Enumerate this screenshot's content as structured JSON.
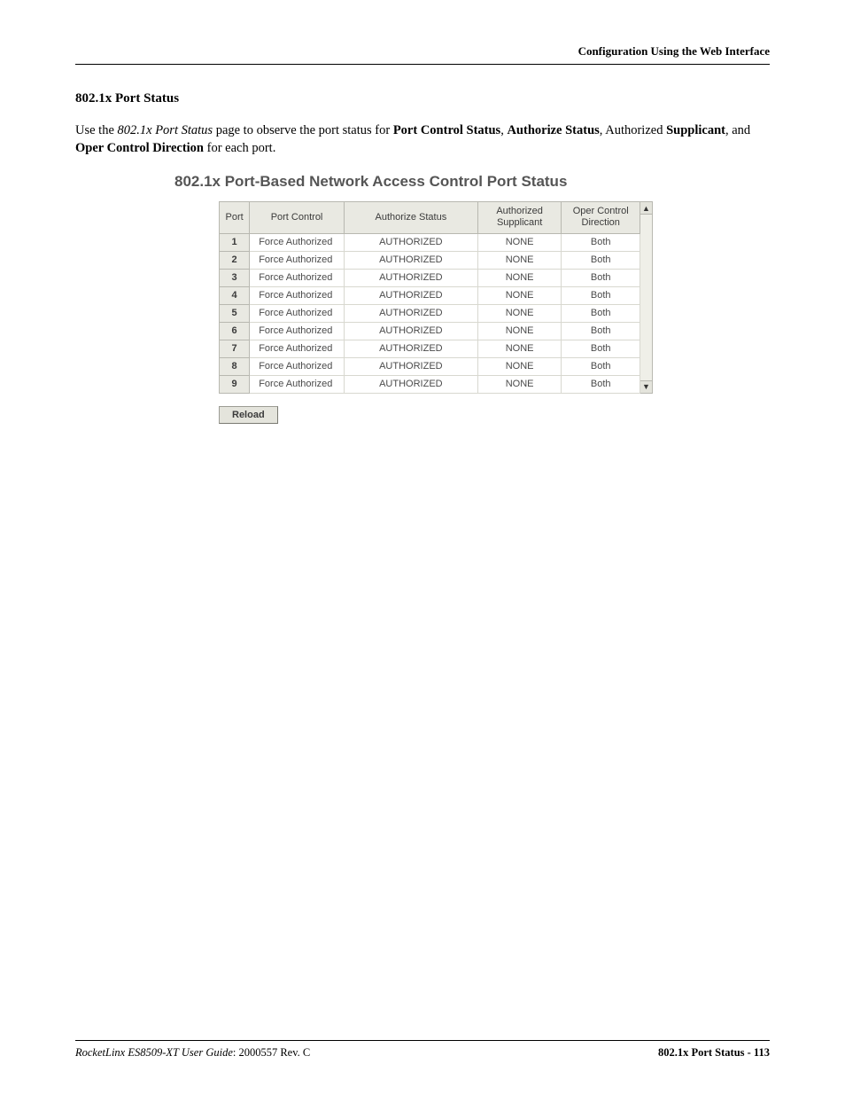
{
  "header": {
    "right": "Configuration Using the Web Interface"
  },
  "section": {
    "title": "802.1x Port Status",
    "intro_prefix": "Use the ",
    "intro_italic": "802.1x Port Status",
    "intro_mid1": " page to observe the port status for ",
    "b1": "Port Control Status",
    "sep1": ", ",
    "b2": "Authorize Status",
    "sep2": ", Authorized ",
    "b3": "Supplicant",
    "sep3": ", and ",
    "b4": "Oper Control Direction",
    "intro_end": " for each port."
  },
  "panel": {
    "title": "802.1x Port-Based Network Access Control Port Status",
    "columns": {
      "port": "Port",
      "port_control": "Port Control",
      "authorize_status": "Authorize Status",
      "authorized_supplicant": "Authorized Supplicant",
      "oper_control_direction": "Oper Control Direction"
    },
    "rows": [
      {
        "port": "1",
        "port_control": "Force Authorized",
        "authorize_status": "AUTHORIZED",
        "authorized_supplicant": "NONE",
        "oper_control_direction": "Both"
      },
      {
        "port": "2",
        "port_control": "Force Authorized",
        "authorize_status": "AUTHORIZED",
        "authorized_supplicant": "NONE",
        "oper_control_direction": "Both"
      },
      {
        "port": "3",
        "port_control": "Force Authorized",
        "authorize_status": "AUTHORIZED",
        "authorized_supplicant": "NONE",
        "oper_control_direction": "Both"
      },
      {
        "port": "4",
        "port_control": "Force Authorized",
        "authorize_status": "AUTHORIZED",
        "authorized_supplicant": "NONE",
        "oper_control_direction": "Both"
      },
      {
        "port": "5",
        "port_control": "Force Authorized",
        "authorize_status": "AUTHORIZED",
        "authorized_supplicant": "NONE",
        "oper_control_direction": "Both"
      },
      {
        "port": "6",
        "port_control": "Force Authorized",
        "authorize_status": "AUTHORIZED",
        "authorized_supplicant": "NONE",
        "oper_control_direction": "Both"
      },
      {
        "port": "7",
        "port_control": "Force Authorized",
        "authorize_status": "AUTHORIZED",
        "authorized_supplicant": "NONE",
        "oper_control_direction": "Both"
      },
      {
        "port": "8",
        "port_control": "Force Authorized",
        "authorize_status": "AUTHORIZED",
        "authorized_supplicant": "NONE",
        "oper_control_direction": "Both"
      },
      {
        "port": "9",
        "port_control": "Force Authorized",
        "authorize_status": "AUTHORIZED",
        "authorized_supplicant": "NONE",
        "oper_control_direction": "Both"
      }
    ],
    "reload_label": "Reload"
  },
  "footer": {
    "left_italic": "RocketLinx ES8509-XT User Guide",
    "left_tail": ": 2000557 Rev. C",
    "right": "802.1x Port Status - 113"
  }
}
